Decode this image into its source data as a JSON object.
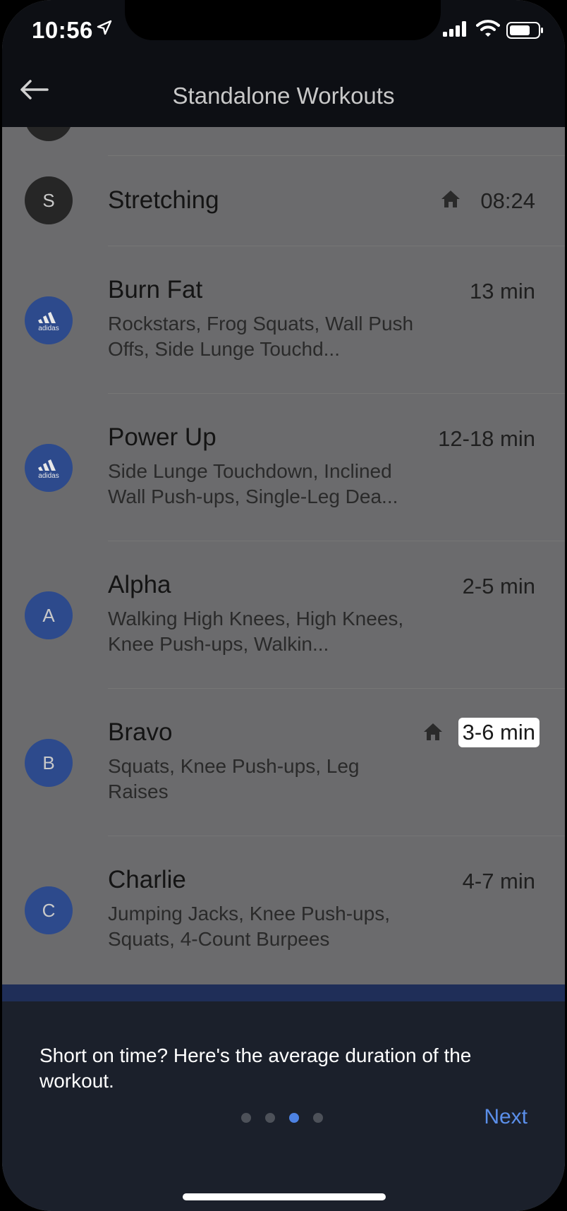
{
  "status_bar": {
    "time": "10:56",
    "icons": [
      "location-arrow-icon",
      "cellular-signal-icon",
      "wifi-icon",
      "battery-icon"
    ]
  },
  "navbar": {
    "title": "Standalone Workouts",
    "back_icon": "back-arrow-icon"
  },
  "workouts": [
    {
      "avatar": "S",
      "avatar_style": "dark",
      "title": "Stretching",
      "subtitle": "",
      "duration": "08:24",
      "home_icon": true
    },
    {
      "avatar": "adidas",
      "avatar_style": "blue",
      "title": "Burn Fat",
      "subtitle": "Rockstars, Frog Squats, Wall Push Offs, Side Lunge Touchd...",
      "duration": "13 min",
      "home_icon": false
    },
    {
      "avatar": "adidas",
      "avatar_style": "blue",
      "title": "Power Up",
      "subtitle": "Side Lunge Touchdown, Inclined Wall Push-ups, Single-Leg Dea...",
      "duration": "12-18 min",
      "home_icon": false
    },
    {
      "avatar": "A",
      "avatar_style": "blue",
      "title": "Alpha",
      "subtitle": "Walking High Knees, High Knees, Knee Push-ups, Walkin...",
      "duration": "2-5 min",
      "home_icon": false
    },
    {
      "avatar": "B",
      "avatar_style": "blue",
      "title": "Bravo",
      "subtitle": "Squats, Knee Push-ups, Leg Raises",
      "duration": "3-6 min",
      "home_icon": true,
      "highlighted": true
    },
    {
      "avatar": "C",
      "avatar_style": "blue",
      "title": "Charlie",
      "subtitle": "Jumping Jacks, Knee Push-ups, Squats, 4-Count Burpees",
      "duration": "4-7 min",
      "home_icon": false
    }
  ],
  "tooltip": {
    "text": "Short on time? Here's the average duration of the workout.",
    "dots_total": 4,
    "dots_active_index": 2,
    "next_label": "Next"
  },
  "colors": {
    "accent": "#5b8fea",
    "avatar_blue": "#2d4a8c",
    "tooltip_bg": "#1b202b"
  }
}
